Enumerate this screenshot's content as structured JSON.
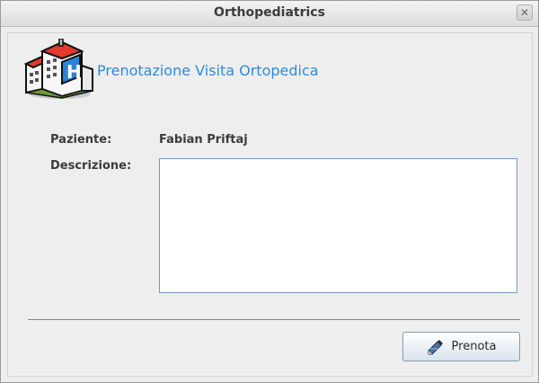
{
  "window": {
    "title": "Orthopediatrics"
  },
  "header": {
    "heading": "Prenotazione Visita Ortopedica",
    "logo_icon": "hospital-icon"
  },
  "form": {
    "patient_label": "Paziente:",
    "patient_value": "Fabian Priftaj",
    "description_label": "Descrizione:",
    "description_value": ""
  },
  "actions": {
    "book_label": "Prenota",
    "book_icon": "pen-icon"
  },
  "colors": {
    "accent": "#2f8ae0",
    "hospital_red": "#e23b2e",
    "hospital_blue": "#2a83d6"
  }
}
